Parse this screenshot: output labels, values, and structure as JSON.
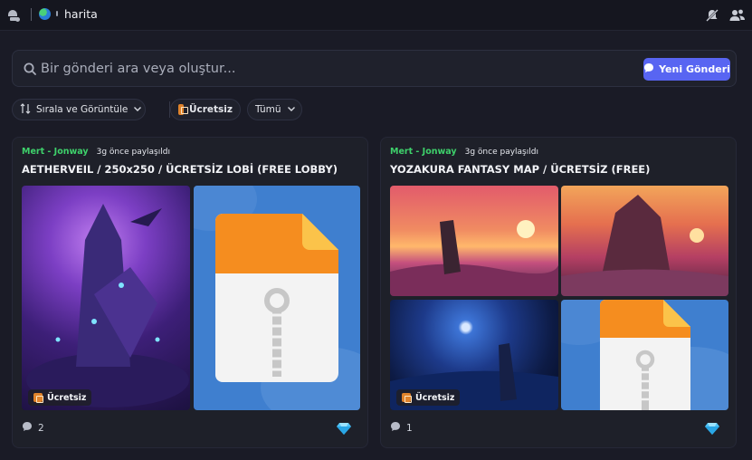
{
  "topbar": {
    "channel_name": "harita"
  },
  "search": {
    "placeholder": "Bir gönderi ara veya oluştur...",
    "new_post_label": "Yeni Gönderi"
  },
  "filters": {
    "sort_label": "Sırala ve Görüntüle",
    "tag_label": "Ücretsiz",
    "all_label": "Tümü"
  },
  "posts": [
    {
      "author": "Mert - Jonway",
      "time": "3g önce paylaşıldı",
      "title": "AETHERVEIL / 250x250 / ÜCRETSİZ LOBİ (FREE LOBBY)",
      "badge": "Ücretsiz",
      "comments": "2"
    },
    {
      "author": "Mert - Jonway",
      "time": "3g önce paylaşıldı",
      "title": "YOZAKURA FANTASY MAP / ÜCRETSİZ (FREE)",
      "badge": "Ücretsiz",
      "comments": "1"
    }
  ],
  "colors": {
    "accent": "#5865f2",
    "author": "#3ed16b",
    "background": "#1a1b26"
  },
  "icons": [
    "threads-icon",
    "globe-icon",
    "mute-notifications-icon",
    "members-icon",
    "search-icon",
    "chat-bubble-icon",
    "sort-icon",
    "chevron-down-icon",
    "tag-icon",
    "zip-file-icon",
    "comment-icon",
    "nitro-gem-icon"
  ]
}
